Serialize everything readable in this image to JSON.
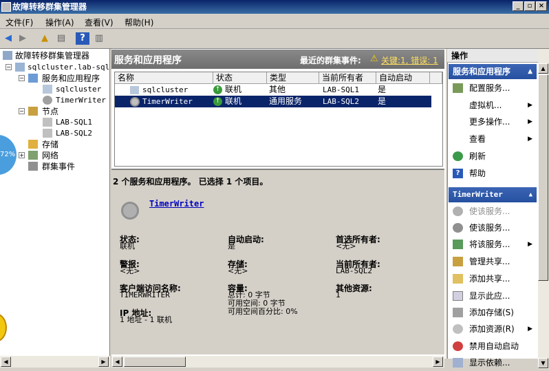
{
  "window": {
    "title": "故障转移群集管理器"
  },
  "menu": [
    "文件(F)",
    "操作(A)",
    "查看(V)",
    "帮助(H)"
  ],
  "tree": {
    "root": "故障转移群集管理器",
    "cluster": "sqlcluster.lab-sql.",
    "services": "服务和应用程序",
    "svc1": "sqlcluster",
    "svc2": "TimerWriter",
    "nodes": "节点",
    "node1": "LAB-SQL1",
    "node2": "LAB-SQL2",
    "storage": "存储",
    "network": "网络",
    "events": "群集事件"
  },
  "overlay": {
    "percent": "72%"
  },
  "center": {
    "title": "服务和应用程序",
    "events_label": "最近的群集事件:",
    "events_value": "关键:1, 错误: 1",
    "columns": [
      "名称",
      "状态",
      "类型",
      "当前所有者",
      "自动启动"
    ],
    "rows": [
      {
        "name": "sqlcluster",
        "status": "联机",
        "type": "其他",
        "owner": "LAB-SQL1",
        "auto": "是"
      },
      {
        "name": "TimerWriter",
        "status": "联机",
        "type": "通用服务",
        "owner": "LAB-SQL2",
        "auto": "是"
      }
    ],
    "summary": "2 个服务和应用程序。  已选择 1 个项目。"
  },
  "details": {
    "name": "TimerWriter",
    "status_label": "状态:",
    "status": "联机",
    "autostart_label": "自动启动:",
    "autostart": "是",
    "pref_owner_label": "首选所有者:",
    "pref_owner": "<无>",
    "alert_label": "警报:",
    "alert": "<无>",
    "storage_label": "存储:",
    "storage": "<无>",
    "cur_owner_label": "当前所有者:",
    "cur_owner": "LAB-SQL2",
    "client_label": "客户端访问名称:",
    "client": "TIMERWRITER",
    "capacity_label": "容量:",
    "cap_total": "总计: 0 字节",
    "cap_free": "可用空间: 0 字节",
    "cap_pct": "可用空间百分比: 0%",
    "other_label": "其他资源:",
    "other": "1",
    "ip_label": "IP 地址:",
    "ip": "1 地址 - 1 联机"
  },
  "actions": {
    "header": "操作",
    "sec1": "服务和应用程序",
    "items1": [
      {
        "label": "配置服务...",
        "arrow": ""
      },
      {
        "label": "虚拟机...",
        "arrow": "▶"
      },
      {
        "label": "更多操作...",
        "arrow": "▶"
      },
      {
        "label": "查看",
        "arrow": "▶"
      },
      {
        "label": "刷新",
        "arrow": ""
      },
      {
        "label": "帮助",
        "arrow": ""
      }
    ],
    "sec2": "TimerWriter",
    "items2": [
      {
        "label": "使该服务...",
        "arrow": ""
      },
      {
        "label": "使该服务...",
        "arrow": ""
      },
      {
        "label": "将该服务...",
        "arrow": "▶"
      },
      {
        "label": "管理共享...",
        "arrow": ""
      },
      {
        "label": "添加共享...",
        "arrow": ""
      },
      {
        "label": "显示此应...",
        "arrow": ""
      },
      {
        "label": "添加存储(S)",
        "arrow": ""
      },
      {
        "label": "添加资源(R)",
        "arrow": "▶"
      },
      {
        "label": "禁用自动启动",
        "arrow": ""
      },
      {
        "label": "显示依赖...",
        "arrow": ""
      }
    ]
  }
}
